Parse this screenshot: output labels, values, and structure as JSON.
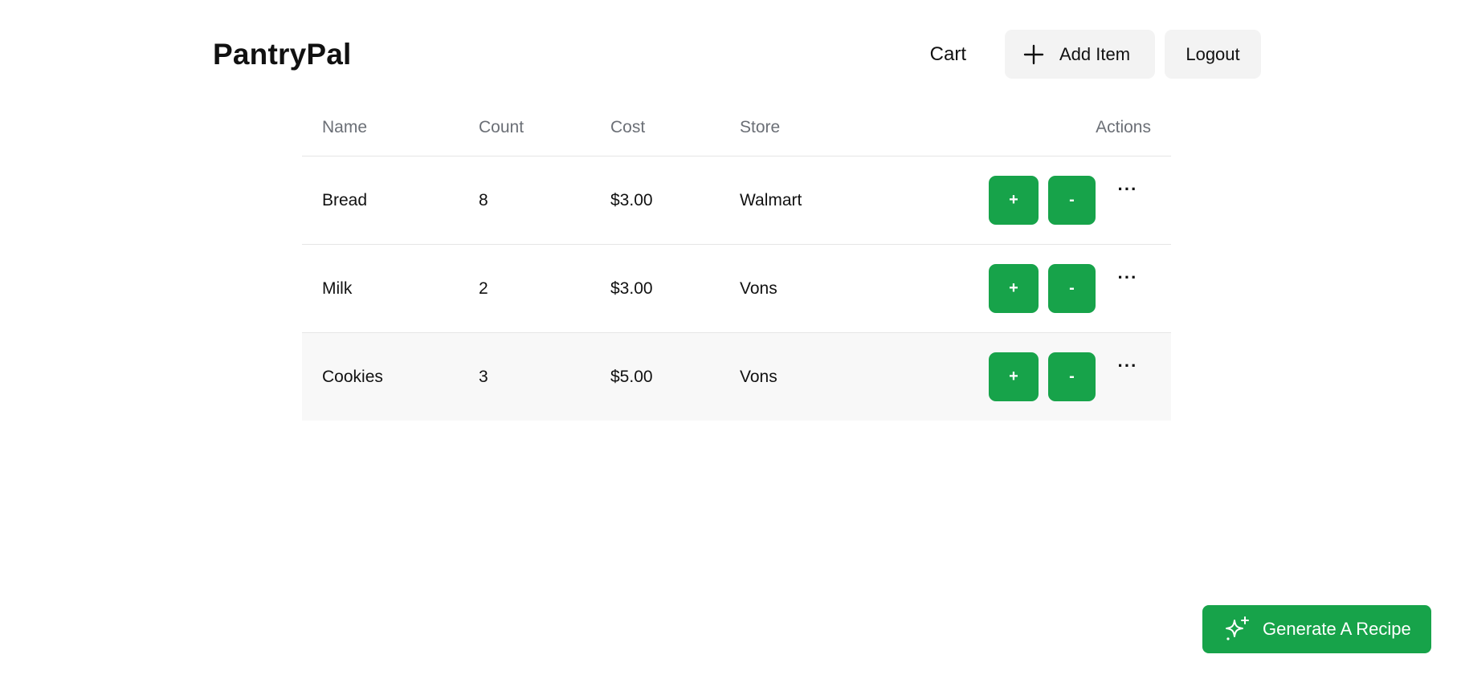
{
  "brand": "PantryPal",
  "nav": {
    "cart_label": "Cart",
    "add_item_label": "Add Item",
    "logout_label": "Logout"
  },
  "table": {
    "headers": {
      "name": "Name",
      "count": "Count",
      "cost": "Cost",
      "store": "Store",
      "actions": "Actions"
    },
    "rows": [
      {
        "name": "Bread",
        "count": "8",
        "cost": "$3.00",
        "store": "Walmart"
      },
      {
        "name": "Milk",
        "count": "2",
        "cost": "$3.00",
        "store": "Vons"
      },
      {
        "name": "Cookies",
        "count": "3",
        "cost": "$5.00",
        "store": "Vons"
      }
    ],
    "increment_label": "+",
    "decrement_label": "-",
    "more_label": "···"
  },
  "generate_recipe_label": "Generate A Recipe",
  "colors": {
    "accent": "#17a34a",
    "button_gray": "#f3f3f3",
    "header_text": "#6b6f76"
  },
  "icons": {
    "add": "plus-icon",
    "generate": "sparkles-icon",
    "more": "ellipsis-icon"
  }
}
